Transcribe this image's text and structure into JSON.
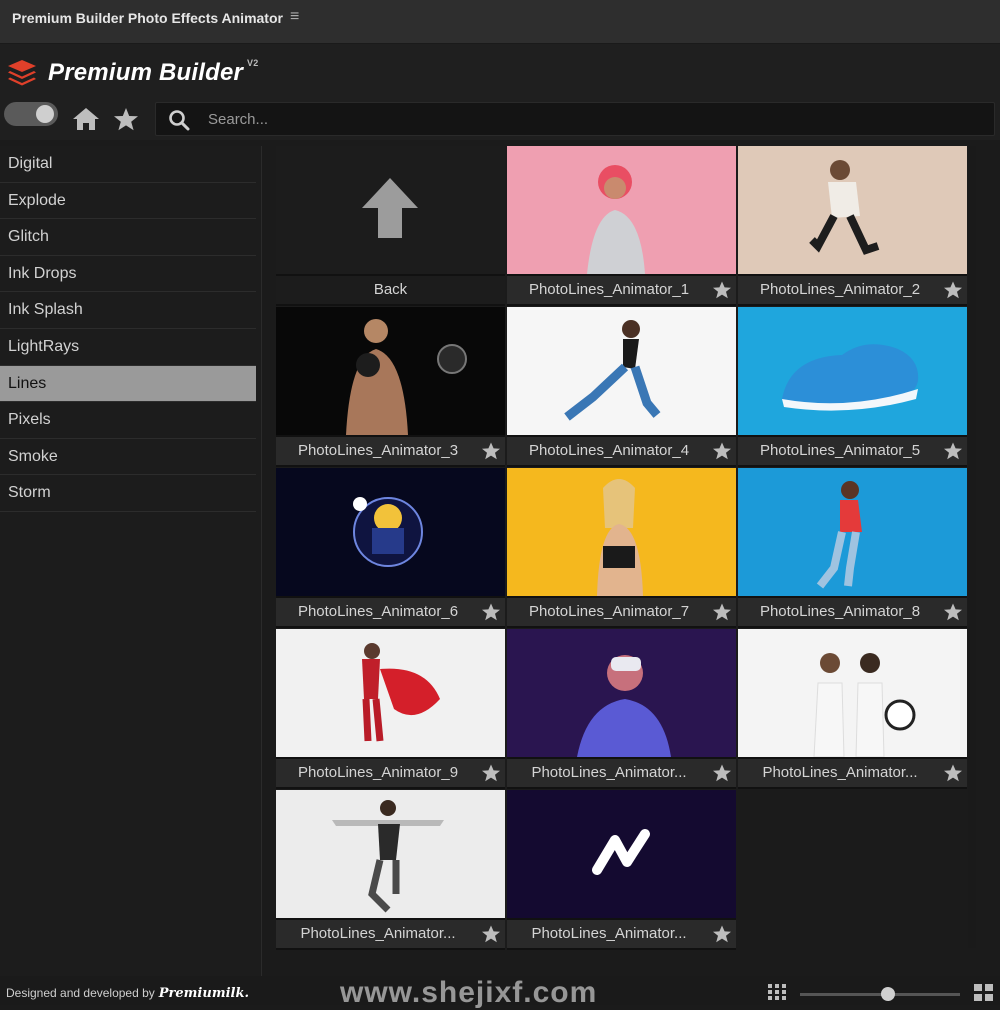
{
  "window": {
    "title": "Premium Builder Photo Effects Animator",
    "menu_icon": "hamburger-icon"
  },
  "brand": {
    "name": "Premium Builder",
    "version": "V2",
    "accent": "#e0402a"
  },
  "toolbar": {
    "search_placeholder": "Search..."
  },
  "sidebar": {
    "items": [
      {
        "label": "Digital"
      },
      {
        "label": "Explode"
      },
      {
        "label": "Glitch"
      },
      {
        "label": "Ink Drops"
      },
      {
        "label": "Ink Splash"
      },
      {
        "label": "LightRays"
      },
      {
        "label": "Lines"
      },
      {
        "label": "Pixels"
      },
      {
        "label": "Smoke"
      },
      {
        "label": "Storm"
      }
    ],
    "selected": "Lines"
  },
  "grid": {
    "back_label": "Back",
    "items": [
      {
        "label": "PhotoLines_Animator_1"
      },
      {
        "label": "PhotoLines_Animator_2"
      },
      {
        "label": "PhotoLines_Animator_3"
      },
      {
        "label": "PhotoLines_Animator_4"
      },
      {
        "label": "PhotoLines_Animator_5"
      },
      {
        "label": "PhotoLines_Animator_6"
      },
      {
        "label": "PhotoLines_Animator_7"
      },
      {
        "label": "PhotoLines_Animator_8"
      },
      {
        "label": "PhotoLines_Animator_9"
      },
      {
        "label": "PhotoLines_Animator..."
      },
      {
        "label": "PhotoLines_Animator..."
      },
      {
        "label": "PhotoLines_Animator..."
      },
      {
        "label": "PhotoLines_Animator..."
      }
    ]
  },
  "footer": {
    "credit": "Designed and developed by",
    "developer": "Premiumilk.",
    "watermark": "www.shejixf.com",
    "zoom_level": 0.55
  }
}
